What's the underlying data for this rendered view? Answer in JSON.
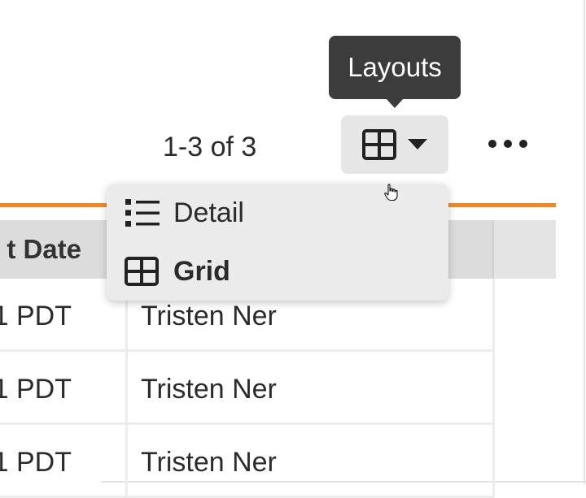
{
  "tooltip": {
    "text": "Layouts"
  },
  "toolbar": {
    "pagination": "1-3 of 3",
    "layouts_icon": "grid-icon",
    "dropdown_icon": "caret-down-icon",
    "more_icon": "ellipsis-icon"
  },
  "layouts_menu": {
    "items": [
      {
        "label": "Detail",
        "icon": "list-icon",
        "selected": false
      },
      {
        "label": "Grid",
        "icon": "grid-icon",
        "selected": true
      }
    ]
  },
  "table": {
    "columns": [
      "t Date",
      ""
    ],
    "rows": [
      {
        "date": "1 PDT",
        "owner": "Tristen Ner"
      },
      {
        "date": "1 PDT",
        "owner": "Tristen Ner"
      },
      {
        "date": "1 PDT",
        "owner": "Tristen Ner"
      }
    ]
  },
  "colors": {
    "accent_rule": "#f0892a",
    "tooltip_bg": "#3c3c3c",
    "button_bg": "#e6e6e6",
    "menu_bg": "#ebebeb",
    "header_bg": "#dcdcdc"
  }
}
